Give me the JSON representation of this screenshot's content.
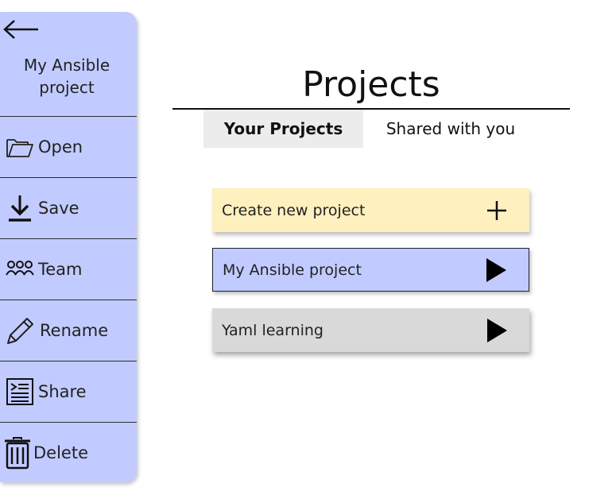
{
  "sidebar": {
    "back_icon": "arrow-left-icon",
    "project_name": "My Ansible\nproject",
    "items": [
      {
        "label": "Open",
        "icon": "folder-open-icon"
      },
      {
        "label": "Save",
        "icon": "download-icon"
      },
      {
        "label": "Team",
        "icon": "team-icon"
      },
      {
        "label": "Rename",
        "icon": "pencil-icon"
      },
      {
        "label": "Share",
        "icon": "share-document-icon"
      },
      {
        "label": "Delete",
        "icon": "trash-icon"
      }
    ]
  },
  "main": {
    "title": "Projects",
    "tabs": [
      {
        "label": "Your Projects",
        "active": true
      },
      {
        "label": "Shared with you",
        "active": false
      }
    ],
    "cards": [
      {
        "label": "Create new project",
        "icon": "plus-icon",
        "color": "#fff0bf"
      },
      {
        "label": "My Ansible project",
        "icon": "play-icon",
        "color": "#c2cbff"
      },
      {
        "label": "Yaml learning",
        "icon": "play-icon",
        "color": "#d9d9d9"
      }
    ]
  },
  "colors": {
    "sidebar_bg": "#c2cbff",
    "create_card_bg": "#fff0bf",
    "selected_card_bg": "#c2cbff",
    "neutral_card_bg": "#d9d9d9",
    "active_tab_bg": "#ececec"
  }
}
